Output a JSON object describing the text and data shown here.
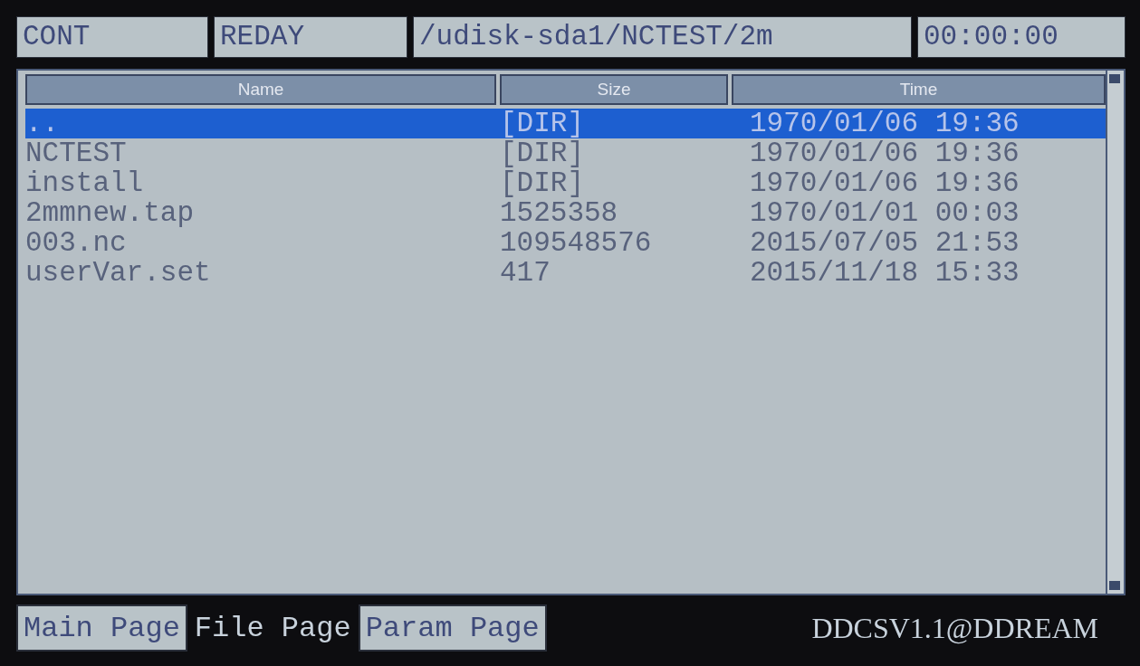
{
  "status_bar": {
    "mode": "CONT",
    "state": "REDAY",
    "path": "/udisk-sda1/NCTEST/2m",
    "timer": "00:00:00"
  },
  "table": {
    "columns": [
      "Name",
      "Size",
      "Time"
    ],
    "rows": [
      {
        "name": "..",
        "size": "[DIR]",
        "time": "1970/01/06 19:36",
        "selected": true
      },
      {
        "name": "NCTEST",
        "size": "[DIR]",
        "time": "1970/01/06 19:36",
        "selected": false
      },
      {
        "name": "install",
        "size": "[DIR]",
        "time": "1970/01/06 19:36",
        "selected": false
      },
      {
        "name": "2mmnew.tap",
        "size": "1525358",
        "time": "1970/01/01 00:03",
        "selected": false
      },
      {
        "name": "003.nc",
        "size": "109548576",
        "time": "2015/07/05 21:53",
        "selected": false
      },
      {
        "name": "userVar.set",
        "size": "417",
        "time": "2015/11/18 15:33",
        "selected": false
      }
    ]
  },
  "tabs": [
    {
      "label": "Main Page",
      "selected": false
    },
    {
      "label": "File Page",
      "selected": true
    },
    {
      "label": "Param Page",
      "selected": false
    }
  ],
  "version": "DDCSV1.1@DDREAM"
}
